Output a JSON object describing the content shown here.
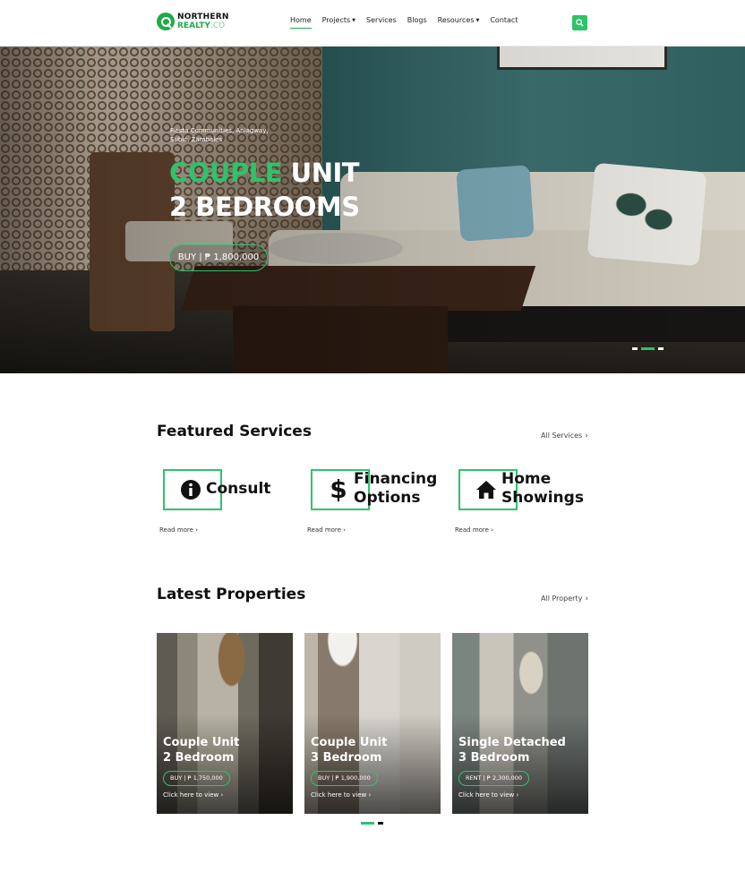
{
  "brand": {
    "line1": "NORTHERN",
    "line2": "REALTY",
    "line2_suffix": ".CO"
  },
  "nav": {
    "items": [
      {
        "label": "Home",
        "active": true,
        "dropdown": false
      },
      {
        "label": "Projects",
        "active": false,
        "dropdown": true
      },
      {
        "label": "Services",
        "active": false,
        "dropdown": false
      },
      {
        "label": "Blogs",
        "active": false,
        "dropdown": false
      },
      {
        "label": "Resources",
        "active": false,
        "dropdown": true
      },
      {
        "label": "Contact",
        "active": false,
        "dropdown": false
      }
    ],
    "search_icon": "search-icon"
  },
  "hero": {
    "location": "Fiesta Communities, Anlagway, Subic, Zambales",
    "title_accent": "COUPLE",
    "title_rest": "UNIT",
    "title_line2": "2 BEDROOMS",
    "cta": "BUY | ₱ 1,800,000",
    "slides_total": 3,
    "slide_active": 2
  },
  "featured": {
    "title": "Featured Services",
    "link": "All Services",
    "items": [
      {
        "icon": "info-icon",
        "label_line1": "Consult",
        "label_line2": "",
        "more": "Read more"
      },
      {
        "icon": "dollar-icon",
        "label_line1": "Financing",
        "label_line2": "Options",
        "more": "Read more"
      },
      {
        "icon": "home-icon",
        "label_line1": "Home",
        "label_line2": "Showings",
        "more": "Read more"
      }
    ]
  },
  "latest": {
    "title": "Latest Properties",
    "link": "All Property",
    "items": [
      {
        "title_line1": "Couple Unit",
        "title_line2": "2 Bedroom",
        "badge": "BUY | ₱ 1,750,000",
        "link": "Click here to view"
      },
      {
        "title_line1": "Couple Unit",
        "title_line2": "3 Bedroom",
        "badge": "BUY | ₱ 1,900,000",
        "link": "Click here to view"
      },
      {
        "title_line1": "Single Detached",
        "title_line2": "3 Bedroom",
        "badge": "RENT | ₱ 2,300,000",
        "link": "Click here to view"
      }
    ],
    "pages_total": 2,
    "page_active": 1
  },
  "colors": {
    "accent": "#2ec36a",
    "brand_green": "#1faa4b",
    "text": "#111111"
  }
}
